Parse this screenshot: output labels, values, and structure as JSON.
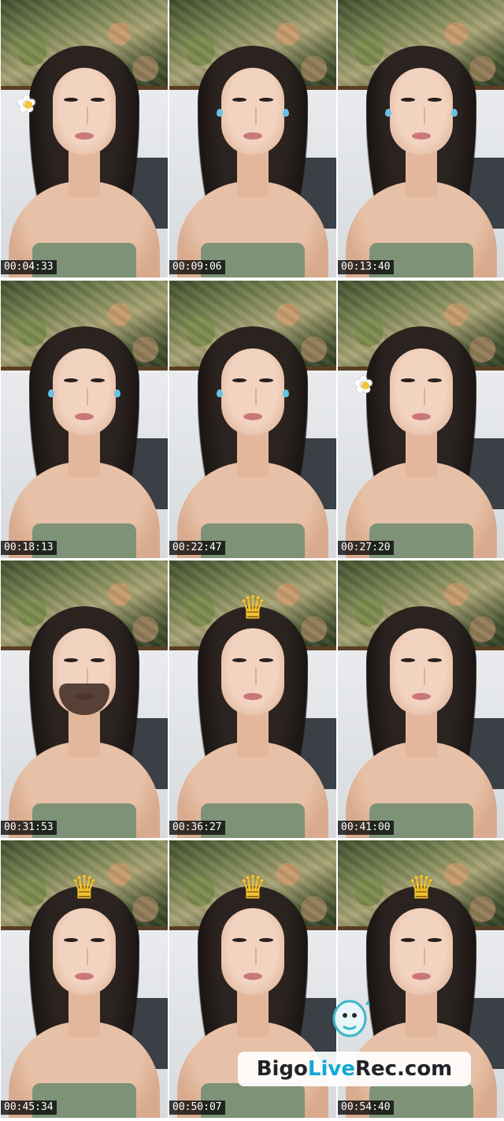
{
  "thumbnails": [
    {
      "time": "00:04:33",
      "filter": "flower-left"
    },
    {
      "time": "00:09:06",
      "filter": "tears"
    },
    {
      "time": "00:13:40",
      "filter": "tears"
    },
    {
      "time": "00:18:13",
      "filter": "tears"
    },
    {
      "time": "00:22:47",
      "filter": "tears"
    },
    {
      "time": "00:27:20",
      "filter": "flower-left"
    },
    {
      "time": "00:31:53",
      "filter": "beard"
    },
    {
      "time": "00:36:27",
      "filter": "crown"
    },
    {
      "time": "00:41:00",
      "filter": "none"
    },
    {
      "time": "00:45:34",
      "filter": "crown"
    },
    {
      "time": "00:50:07",
      "filter": "crown"
    },
    {
      "time": "00:54:40",
      "filter": "crown"
    }
  ],
  "watermark": {
    "part1": "Bigo",
    "part2": "Live",
    "part3": "Rec.com"
  },
  "colors": {
    "watermark_accent": "#11a8d6",
    "dress": "#7d9277",
    "crown": "#f2c12e"
  }
}
